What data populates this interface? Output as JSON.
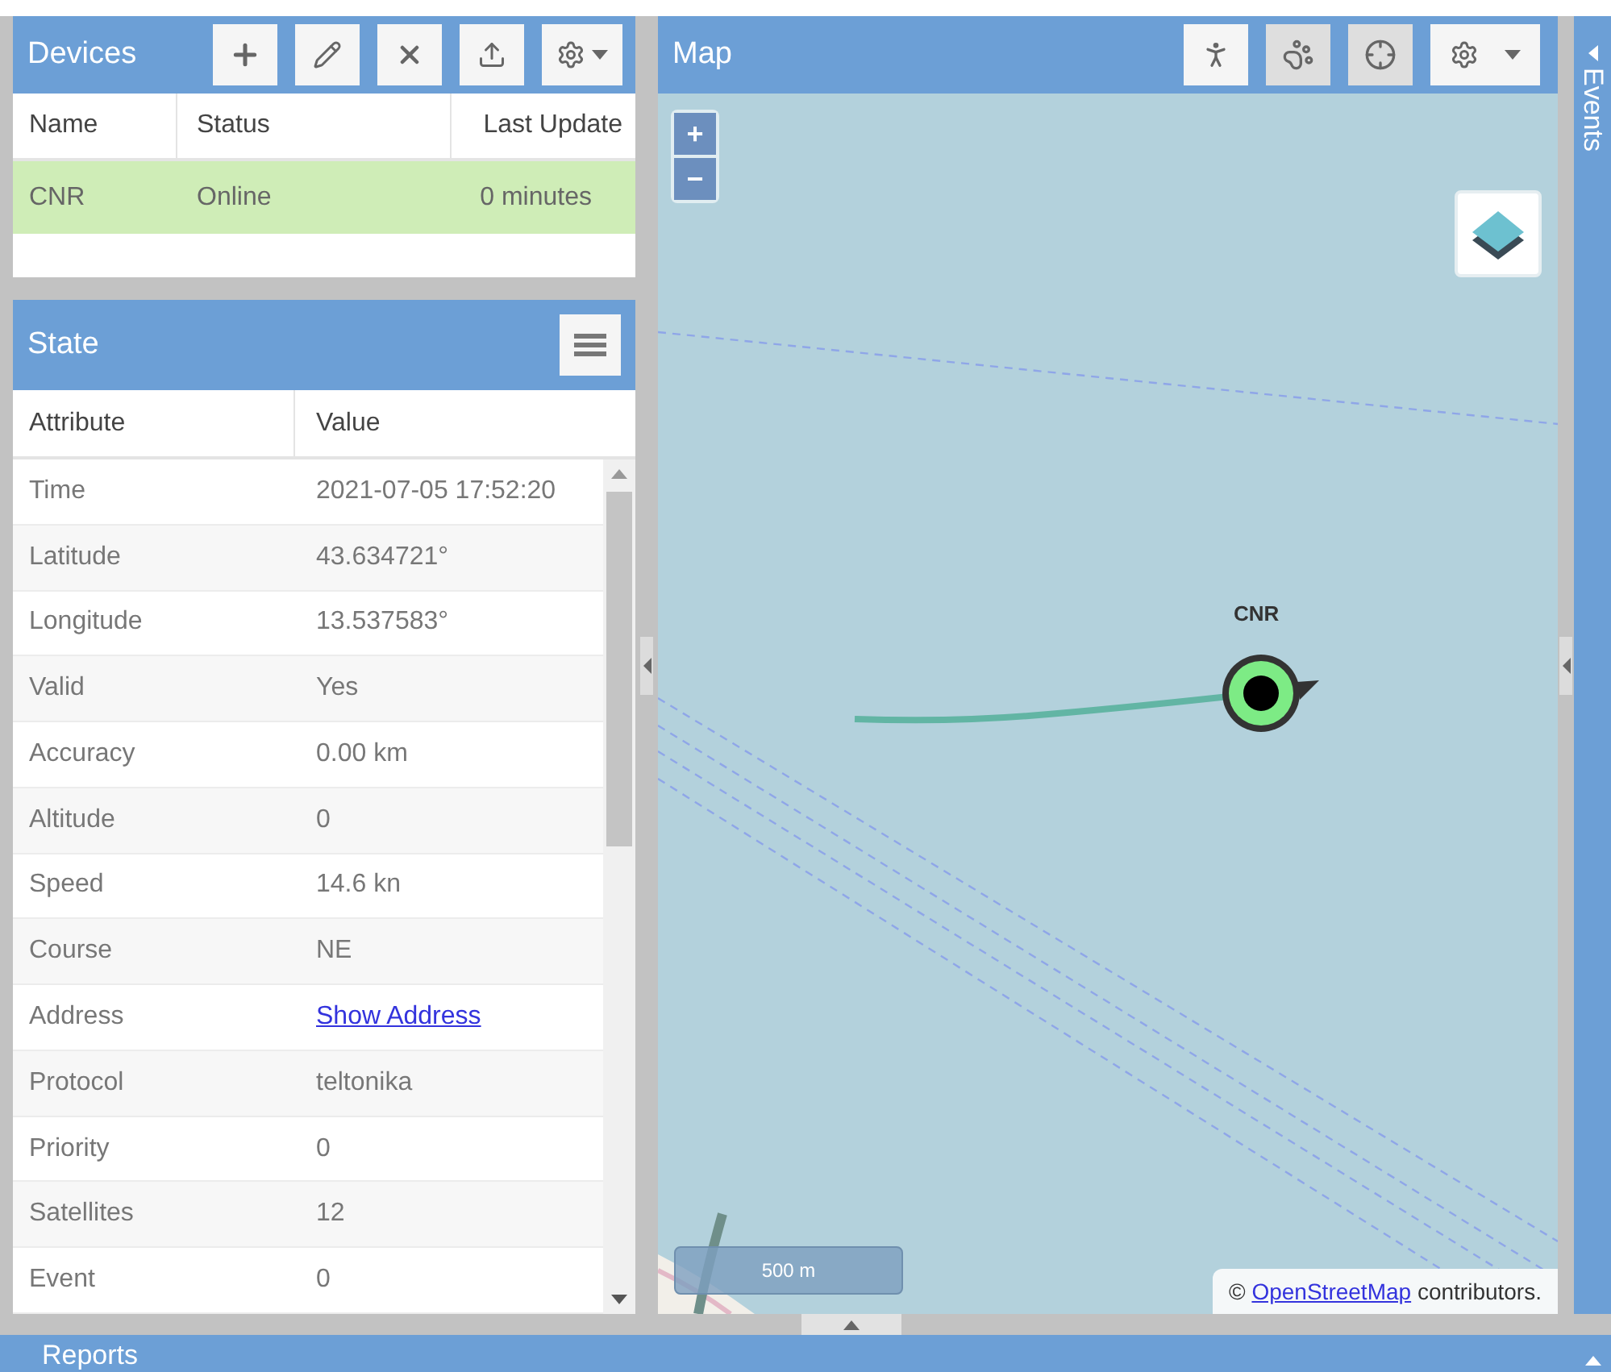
{
  "devices": {
    "title": "Devices",
    "columns": [
      "Name",
      "Status",
      "Last Update"
    ],
    "rows": [
      {
        "cells": [
          "CNR",
          "Online",
          "0 minutes"
        ],
        "selected": true
      }
    ]
  },
  "state": {
    "title": "State",
    "columns": [
      "Attribute",
      "Value"
    ],
    "rows": [
      {
        "attribute": "Time",
        "value": "2021-07-05 17:52:20",
        "kind": "text"
      },
      {
        "attribute": "Latitude",
        "value": "43.634721°",
        "kind": "text"
      },
      {
        "attribute": "Longitude",
        "value": "13.537583°",
        "kind": "text"
      },
      {
        "attribute": "Valid",
        "value": "Yes",
        "kind": "text"
      },
      {
        "attribute": "Accuracy",
        "value": "0.00 km",
        "kind": "text"
      },
      {
        "attribute": "Altitude",
        "value": "0",
        "kind": "text"
      },
      {
        "attribute": "Speed",
        "value": "14.6 kn",
        "kind": "text"
      },
      {
        "attribute": "Course",
        "value": "NE",
        "kind": "text"
      },
      {
        "attribute": "Address",
        "value": "Show Address",
        "kind": "link"
      },
      {
        "attribute": "Protocol",
        "value": "teltonika",
        "kind": "text"
      },
      {
        "attribute": "Priority",
        "value": "0",
        "kind": "text"
      },
      {
        "attribute": "Satellites",
        "value": "12",
        "kind": "text"
      },
      {
        "attribute": "Event",
        "value": "0",
        "kind": "text"
      }
    ]
  },
  "map": {
    "title": "Map",
    "toggles": [
      {
        "selected": false
      },
      {
        "selected": true
      },
      {
        "selected": true
      }
    ],
    "zoom_in": "+",
    "zoom_out": "−",
    "marker_label": "CNR",
    "scale": "500 m",
    "attribution": {
      "prefix": "©",
      "link": "OpenStreetMap",
      "suffix": "contributors."
    }
  },
  "events": {
    "title": "Events"
  },
  "reports": {
    "title": "Reports"
  }
}
